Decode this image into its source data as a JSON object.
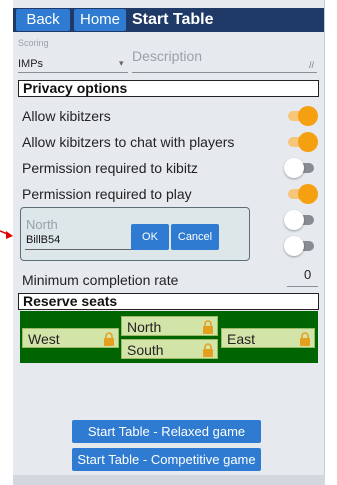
{
  "header": {
    "back_label": "Back",
    "home_label": "Home",
    "title": "Start Table"
  },
  "scoring": {
    "label": "Scoring",
    "value": "IMPs",
    "description_placeholder": "Description"
  },
  "privacy": {
    "heading": "Privacy options",
    "options": [
      {
        "label": "Allow kibitzers",
        "on": true
      },
      {
        "label": "Allow kibitzers to chat with players",
        "on": true
      },
      {
        "label": "Permission required to kibitz",
        "on": false
      },
      {
        "label": "Permission required to play",
        "on": true
      }
    ],
    "hidden_toggles": [
      {
        "on": false
      },
      {
        "on": false
      }
    ]
  },
  "popup": {
    "placeholder": "North",
    "value": "BillB54",
    "ok_label": "OK",
    "cancel_label": "Cancel"
  },
  "min_completion": {
    "label": "Minimum completion rate",
    "value": "0"
  },
  "reserve": {
    "heading": "Reserve seats",
    "north": "North",
    "south": "South",
    "west": "West",
    "east": "East"
  },
  "buttons": {
    "relaxed_label": "Start Table - Relaxed game",
    "competitive_label": "Start Table - Competitive game"
  },
  "colors": {
    "header": "#1f3a66",
    "button": "#2e7bd1",
    "toggle_on": "#f5a010",
    "seat_area": "#006400",
    "seat": "#d3e4a8",
    "lock": "#e6a020",
    "arrow": "#e00000"
  }
}
